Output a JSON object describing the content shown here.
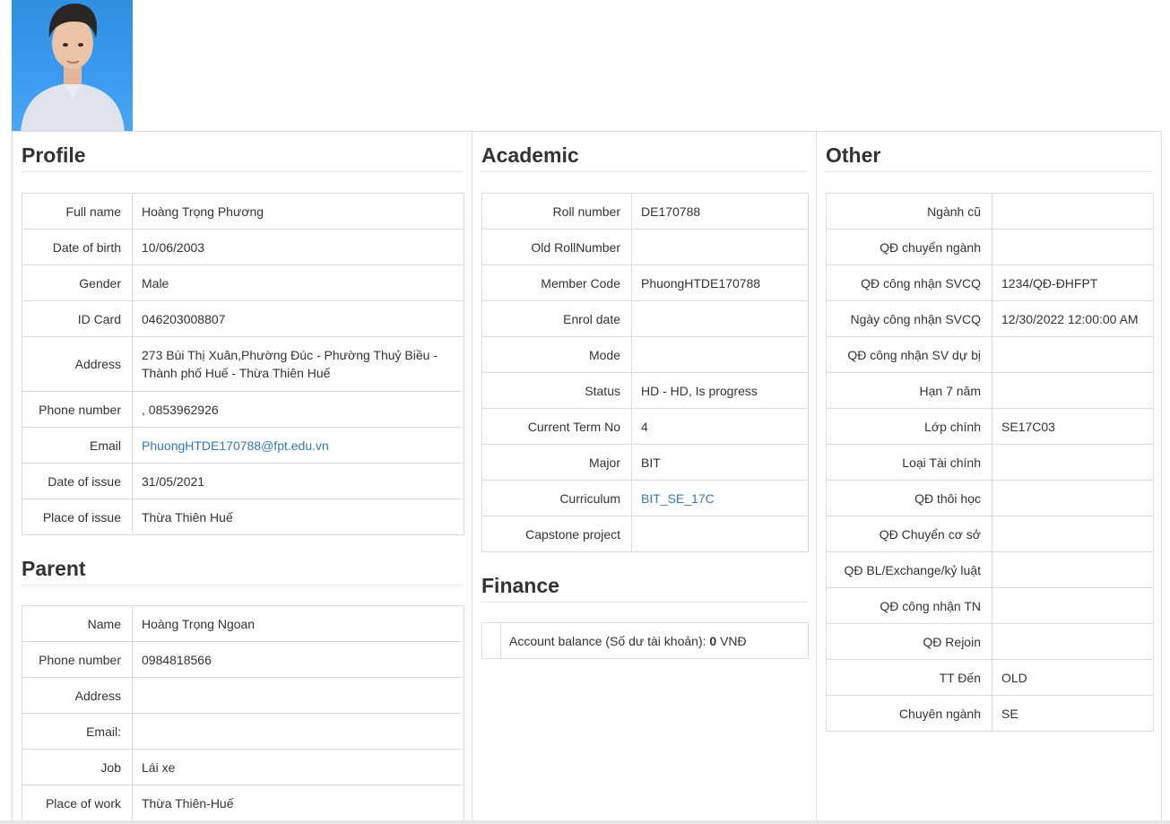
{
  "profile": {
    "title": "Profile",
    "rows": [
      {
        "label": "Full name",
        "value": "Hoàng Trọng Phương"
      },
      {
        "label": "Date of birth",
        "value": "10/06/2003"
      },
      {
        "label": "Gender",
        "value": "Male"
      },
      {
        "label": "ID Card",
        "value": "046203008807"
      },
      {
        "label": "Address",
        "value": "273 Bùi Thị Xuân,Phường Đúc - Phường Thuỷ Biều - Thành phố Huế - Thừa Thiên Huế"
      },
      {
        "label": "Phone number",
        "value": ", 0853962926"
      },
      {
        "label": "Email",
        "value": "PhuongHTDE170788@fpt.edu.vn"
      },
      {
        "label": "Date of issue",
        "value": "31/05/2021"
      },
      {
        "label": "Place of issue",
        "value": "Thừa Thiên Huế"
      }
    ]
  },
  "parent": {
    "title": "Parent",
    "rows": [
      {
        "label": "Name",
        "value": "Hoàng Trọng Ngoan"
      },
      {
        "label": "Phone number",
        "value": "0984818566"
      },
      {
        "label": "Address",
        "value": ""
      },
      {
        "label": "Email:",
        "value": ""
      },
      {
        "label": "Job",
        "value": "Lái xe"
      },
      {
        "label": "Place of work",
        "value": "Thừa Thiên-Huế"
      }
    ]
  },
  "academic": {
    "title": "Academic",
    "rows": [
      {
        "label": "Roll number",
        "value": "DE170788"
      },
      {
        "label": "Old RollNumber",
        "value": ""
      },
      {
        "label": "Member Code",
        "value": "PhuongHTDE170788"
      },
      {
        "label": "Enrol date",
        "value": ""
      },
      {
        "label": "Mode",
        "value": ""
      },
      {
        "label": "Status",
        "value": "HD - HD, Is progress"
      },
      {
        "label": "Current Term No",
        "value": "4"
      },
      {
        "label": "Major",
        "value": "BIT"
      },
      {
        "label": "Curriculum",
        "value": "BIT_SE_17C"
      },
      {
        "label": "Capstone project",
        "value": ""
      }
    ]
  },
  "finance": {
    "title": "Finance",
    "balance_label": "Account balance (Số dư tài khoản):",
    "balance_amount": "0",
    "balance_currency": "VNĐ"
  },
  "other": {
    "title": "Other",
    "rows": [
      {
        "label": "Ngành cũ",
        "value": ""
      },
      {
        "label": "QĐ chuyển ngành",
        "value": ""
      },
      {
        "label": "QĐ công nhận SVCQ",
        "value": "1234/QĐ-ĐHFPT"
      },
      {
        "label": "Ngày công nhận SVCQ",
        "value": "12/30/2022 12:00:00 AM"
      },
      {
        "label": "QĐ công nhận SV dự bị",
        "value": ""
      },
      {
        "label": "Hạn 7 năm",
        "value": ""
      },
      {
        "label": "Lớp chính",
        "value": "SE17C03"
      },
      {
        "label": "Loại Tài chính",
        "value": ""
      },
      {
        "label": "QĐ thôi học",
        "value": ""
      },
      {
        "label": "QĐ Chuyển cơ sở",
        "value": ""
      },
      {
        "label": "QĐ BL/Exchange/kỷ luật",
        "value": ""
      },
      {
        "label": "QĐ công nhận TN",
        "value": ""
      },
      {
        "label": "QĐ Rejoin",
        "value": ""
      },
      {
        "label": "TT Đến",
        "value": "OLD"
      },
      {
        "label": "Chuyên ngành",
        "value": "SE"
      }
    ]
  }
}
